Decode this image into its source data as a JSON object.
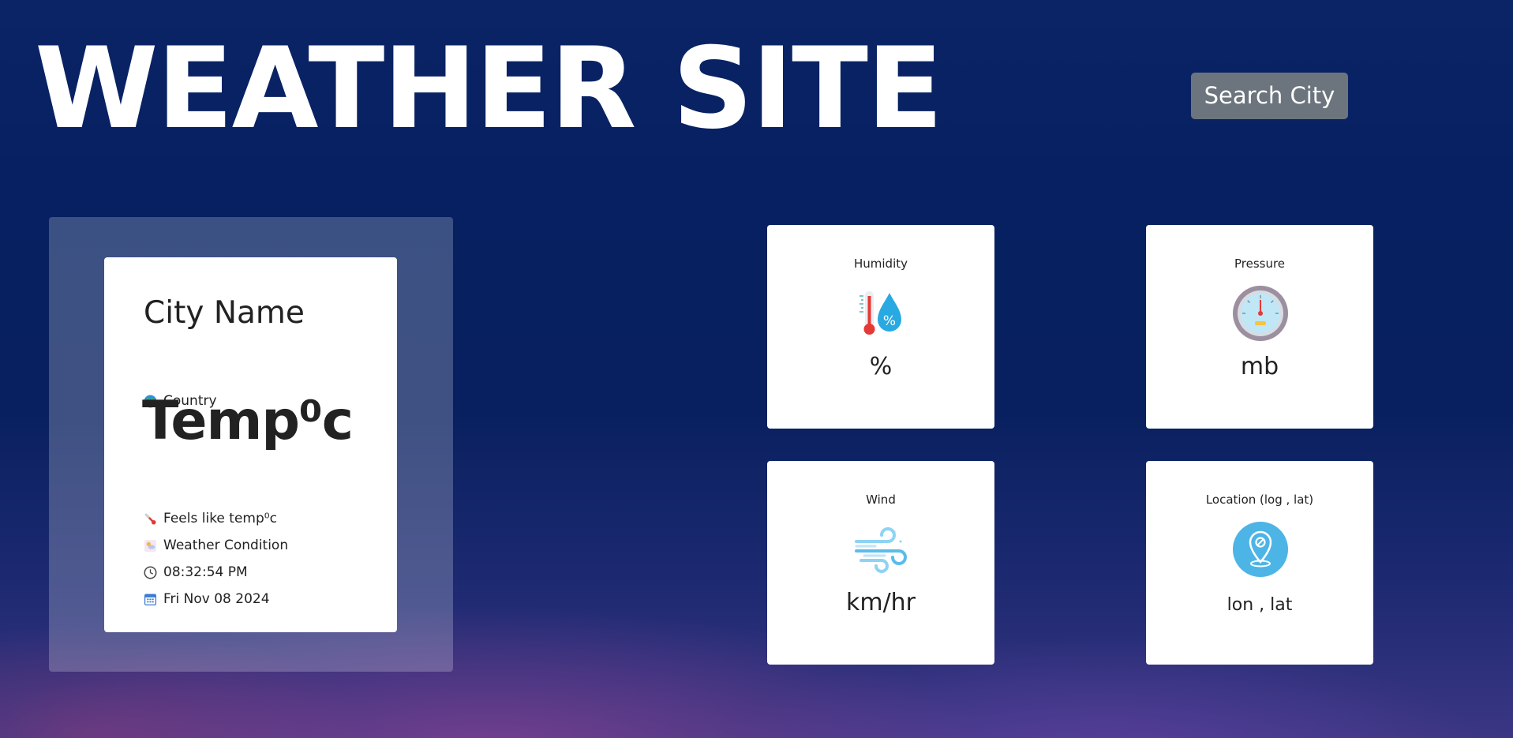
{
  "header": {
    "title": "WEATHER SITE",
    "search_button_label": "Search City"
  },
  "city_card": {
    "city_name": "City Name",
    "country": "Country",
    "temperature": "Temp⁰c",
    "feels_like": "Feels like temp⁰c",
    "condition": "Weather Condition",
    "time": "08:32:54 PM",
    "date": "Fri Nov 08 2024",
    "icons": [
      "globe-icon",
      "thermometer-icon",
      "weather-condition-icon",
      "clock-icon",
      "calendar-icon"
    ]
  },
  "stats": {
    "humidity": {
      "title": "Humidity",
      "value": "%",
      "icon": "humidity-icon"
    },
    "pressure": {
      "title": "Pressure",
      "value": "mb",
      "icon": "pressure-gauge-icon"
    },
    "wind": {
      "title": "Wind",
      "value": "km/hr",
      "icon": "wind-icon"
    },
    "location": {
      "title": "Location (log , lat)",
      "value": "lon , lat",
      "icon": "location-pin-icon"
    }
  },
  "colors": {
    "background_top": "#062061",
    "background_bottom": "#3b3683",
    "button_bg": "#6c757d",
    "card_bg": "#ffffff",
    "text_dark": "#222222"
  }
}
